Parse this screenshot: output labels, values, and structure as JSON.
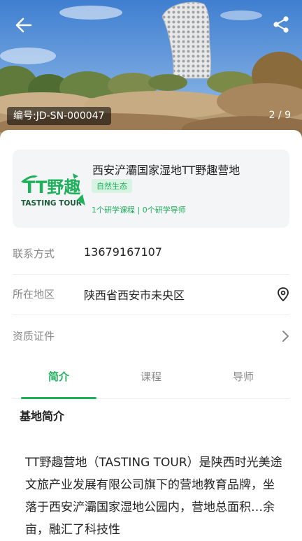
{
  "hero": {
    "code": "编号:JD-SN-000047",
    "page_indicator": "2 / 9"
  },
  "camp": {
    "name": "西安浐灞国家湿地TT野趣营地",
    "tag": "自然生态",
    "stats": "1个研学课程 | 0个研学导师"
  },
  "logo": {
    "wordmark": "TT野趣",
    "subtext": "TASTING TOUR"
  },
  "details": {
    "contact_label": "联系方式",
    "contact_value": "13679167107",
    "area_label": "所在地区",
    "area_value": "陕西省西安市未央区",
    "cert_label": "资质证件"
  },
  "tabs": [
    {
      "label": "简介",
      "active": true
    },
    {
      "label": "课程",
      "active": false
    },
    {
      "label": "导师",
      "active": false
    }
  ],
  "intro": {
    "title": "基地简介",
    "text": "TT野趣营地（TASTING TOUR）是陕西时光美途文旅产业发展有限公司旗下的营地教育品牌，坐落于西安浐灞国家湿地公园内，营地总面积…余亩，融汇了科技性"
  },
  "colors": {
    "accent": "#1fb05c",
    "tag_bg": "#d8f3e2",
    "card_bg": "#f4f5f7"
  },
  "icons": {
    "back": "arrow-left-icon",
    "share": "share-icon",
    "location": "location-pin-icon",
    "cert": "chevron-right-icon"
  }
}
